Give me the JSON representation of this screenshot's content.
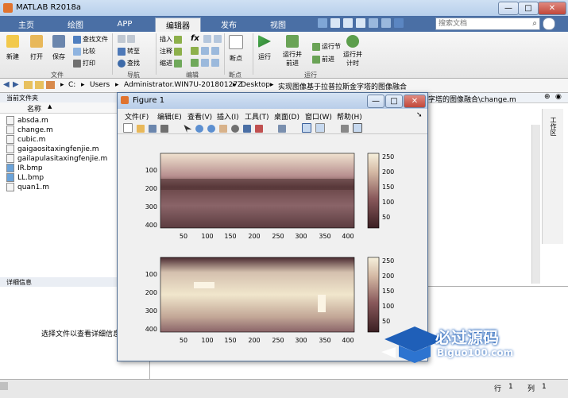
{
  "app": {
    "title": "MATLAB R2018a",
    "window_buttons": [
      "—",
      "□",
      "✕"
    ]
  },
  "ribbon": {
    "tabs": [
      "主页",
      "绘图",
      "APP",
      "编辑器",
      "发布",
      "视图"
    ],
    "active_tab": "编辑器",
    "search_placeholder": "搜索文档",
    "groups": [
      "文件",
      "导航",
      "编辑",
      "断点",
      "运行"
    ],
    "file": {
      "new": "新建",
      "open": "打开",
      "save": "保存",
      "find_files": "查找文件",
      "compare": "比较",
      "print": "打印"
    },
    "navigate": {
      "goto": "转至",
      "find": "查找"
    },
    "edit": {
      "insert": "插入",
      "comment": "注释",
      "indent": "缩进",
      "fx": "fx"
    },
    "breakpoints": {
      "label": "断点"
    },
    "run": {
      "run": "运行",
      "run_advance_1": "运行并",
      "run_advance_2": "前进",
      "run_section": "运行节",
      "advance": "前进",
      "run_time_1": "运行并",
      "run_time_2": "计时"
    }
  },
  "address": {
    "crumbs": [
      "C:",
      "Users",
      "Administrator.WIN7U-20180127Z",
      "Desktop",
      "实现图像基于拉普拉斯金字塔的图像融合"
    ]
  },
  "current_folder": {
    "title": "当前文件夹",
    "column": "名称",
    "files": [
      "absda.m",
      "change.m",
      "cubic.m",
      "gaigaositaxingfenjie.m",
      "gailapulasitaxingfenjie.m",
      "IR.bmp",
      "LL.bmp",
      "quan1.m"
    ]
  },
  "details": {
    "title": "详细信息",
    "message": "选择文件以查看详细信息"
  },
  "editor": {
    "tab_text": "字塔的图像融合\\change.m"
  },
  "status": {
    "row_label": "行",
    "row_value": "1",
    "col_label": "列",
    "col_value": "1"
  },
  "figure": {
    "title": "Figure 1",
    "menu": [
      "文件(F)",
      "编辑(E)",
      "查看(V)",
      "插入(I)",
      "工具(T)",
      "桌面(D)",
      "窗口(W)",
      "帮助(H)"
    ],
    "yticks": [
      "100",
      "200",
      "300",
      "400"
    ],
    "xticks": [
      "50",
      "100",
      "150",
      "200",
      "250",
      "300",
      "350",
      "400"
    ],
    "colorbar_ticks": [
      "250",
      "200",
      "150",
      "100",
      "50"
    ]
  },
  "watermark": {
    "text": "必过源码",
    "url": "Biguo100.com"
  },
  "colors": {
    "accent": "#4a6fa5",
    "image_dark": "#3a1f22",
    "image_light": "#f1e6cc"
  }
}
